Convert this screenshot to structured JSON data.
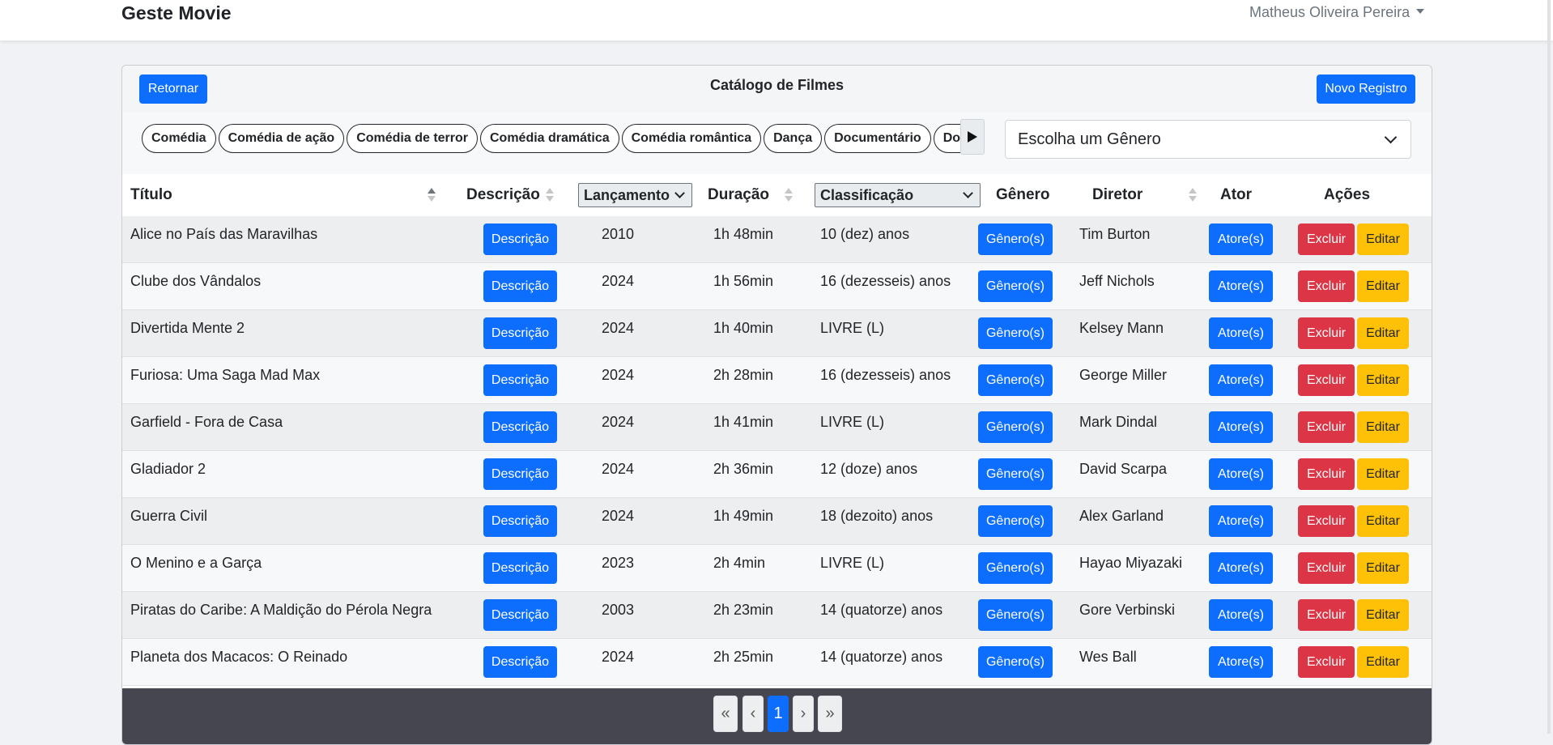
{
  "navbar": {
    "brand": "Geste Movie",
    "user_name": "Matheus Oliveira Pereira"
  },
  "card": {
    "title": "Catálogo de Filmes",
    "back_label": "Retornar",
    "new_label": "Novo Registro"
  },
  "filters": {
    "genres": [
      "Comédia",
      "Comédia de ação",
      "Comédia de terror",
      "Comédia dramática",
      "Comédia romântica",
      "Dança",
      "Documentário",
      "Documentário"
    ],
    "next_icon": "triangle-right-icon",
    "genre_select": "Escolha um Gênero"
  },
  "table": {
    "headers": {
      "titulo": "Título",
      "descricao": "Descrição",
      "lancamento": "Lançamento",
      "duracao": "Duração",
      "classificacao": "Classificação",
      "genero": "Gênero",
      "diretor": "Diretor",
      "ator": "Ator",
      "acoes": "Ações"
    },
    "rows": [
      {
        "titulo": "Alice no País das Maravilhas",
        "lancamento": "2010",
        "duracao": "1h 48min",
        "classificacao": "10 (dez) anos",
        "diretor": "Tim Burton"
      },
      {
        "titulo": "Clube dos Vândalos",
        "lancamento": "2024",
        "duracao": "1h 56min",
        "classificacao": "16 (dezesseis) anos",
        "diretor": "Jeff Nichols"
      },
      {
        "titulo": "Divertida Mente 2",
        "lancamento": "2024",
        "duracao": "1h 40min",
        "classificacao": "LIVRE (L)",
        "diretor": "Kelsey Mann"
      },
      {
        "titulo": "Furiosa: Uma Saga Mad Max",
        "lancamento": "2024",
        "duracao": "2h 28min",
        "classificacao": "16 (dezesseis) anos",
        "diretor": "George Miller"
      },
      {
        "titulo": "Garfield - Fora de Casa",
        "lancamento": "2024",
        "duracao": "1h 41min",
        "classificacao": "LIVRE (L)",
        "diretor": "Mark Dindal"
      },
      {
        "titulo": "Gladiador 2",
        "lancamento": "2024",
        "duracao": "2h 36min",
        "classificacao": "12 (doze) anos",
        "diretor": "David Scarpa"
      },
      {
        "titulo": "Guerra Civil",
        "lancamento": "2024",
        "duracao": "1h 49min",
        "classificacao": "18 (dezoito) anos",
        "diretor": "Alex Garland"
      },
      {
        "titulo": "O Menino e a Garça",
        "lancamento": "2023",
        "duracao": "2h 4min",
        "classificacao": "LIVRE (L)",
        "diretor": "Hayao Miyazaki"
      },
      {
        "titulo": "Piratas do Caribe: A Maldição do Pérola Negra",
        "lancamento": "2003",
        "duracao": "2h 23min",
        "classificacao": "14 (quatorze) anos",
        "diretor": "Gore Verbinski"
      },
      {
        "titulo": "Planeta dos Macacos: O Reinado",
        "lancamento": "2024",
        "duracao": "2h 25min",
        "classificacao": "14 (quatorze) anos",
        "diretor": "Wes Ball"
      }
    ],
    "row_buttons": {
      "descricao": "Descrição",
      "genero": "Gênero(s)",
      "ator": "Atore(s)",
      "excluir": "Excluir",
      "editar": "Editar"
    }
  },
  "pagination": {
    "first": "«",
    "prev": "‹",
    "current": "1",
    "next": "›",
    "last": "»"
  },
  "colors": {
    "primary": "#0d6efd",
    "danger": "#dc3545",
    "warning": "#ffc107",
    "footer": "#464650"
  }
}
